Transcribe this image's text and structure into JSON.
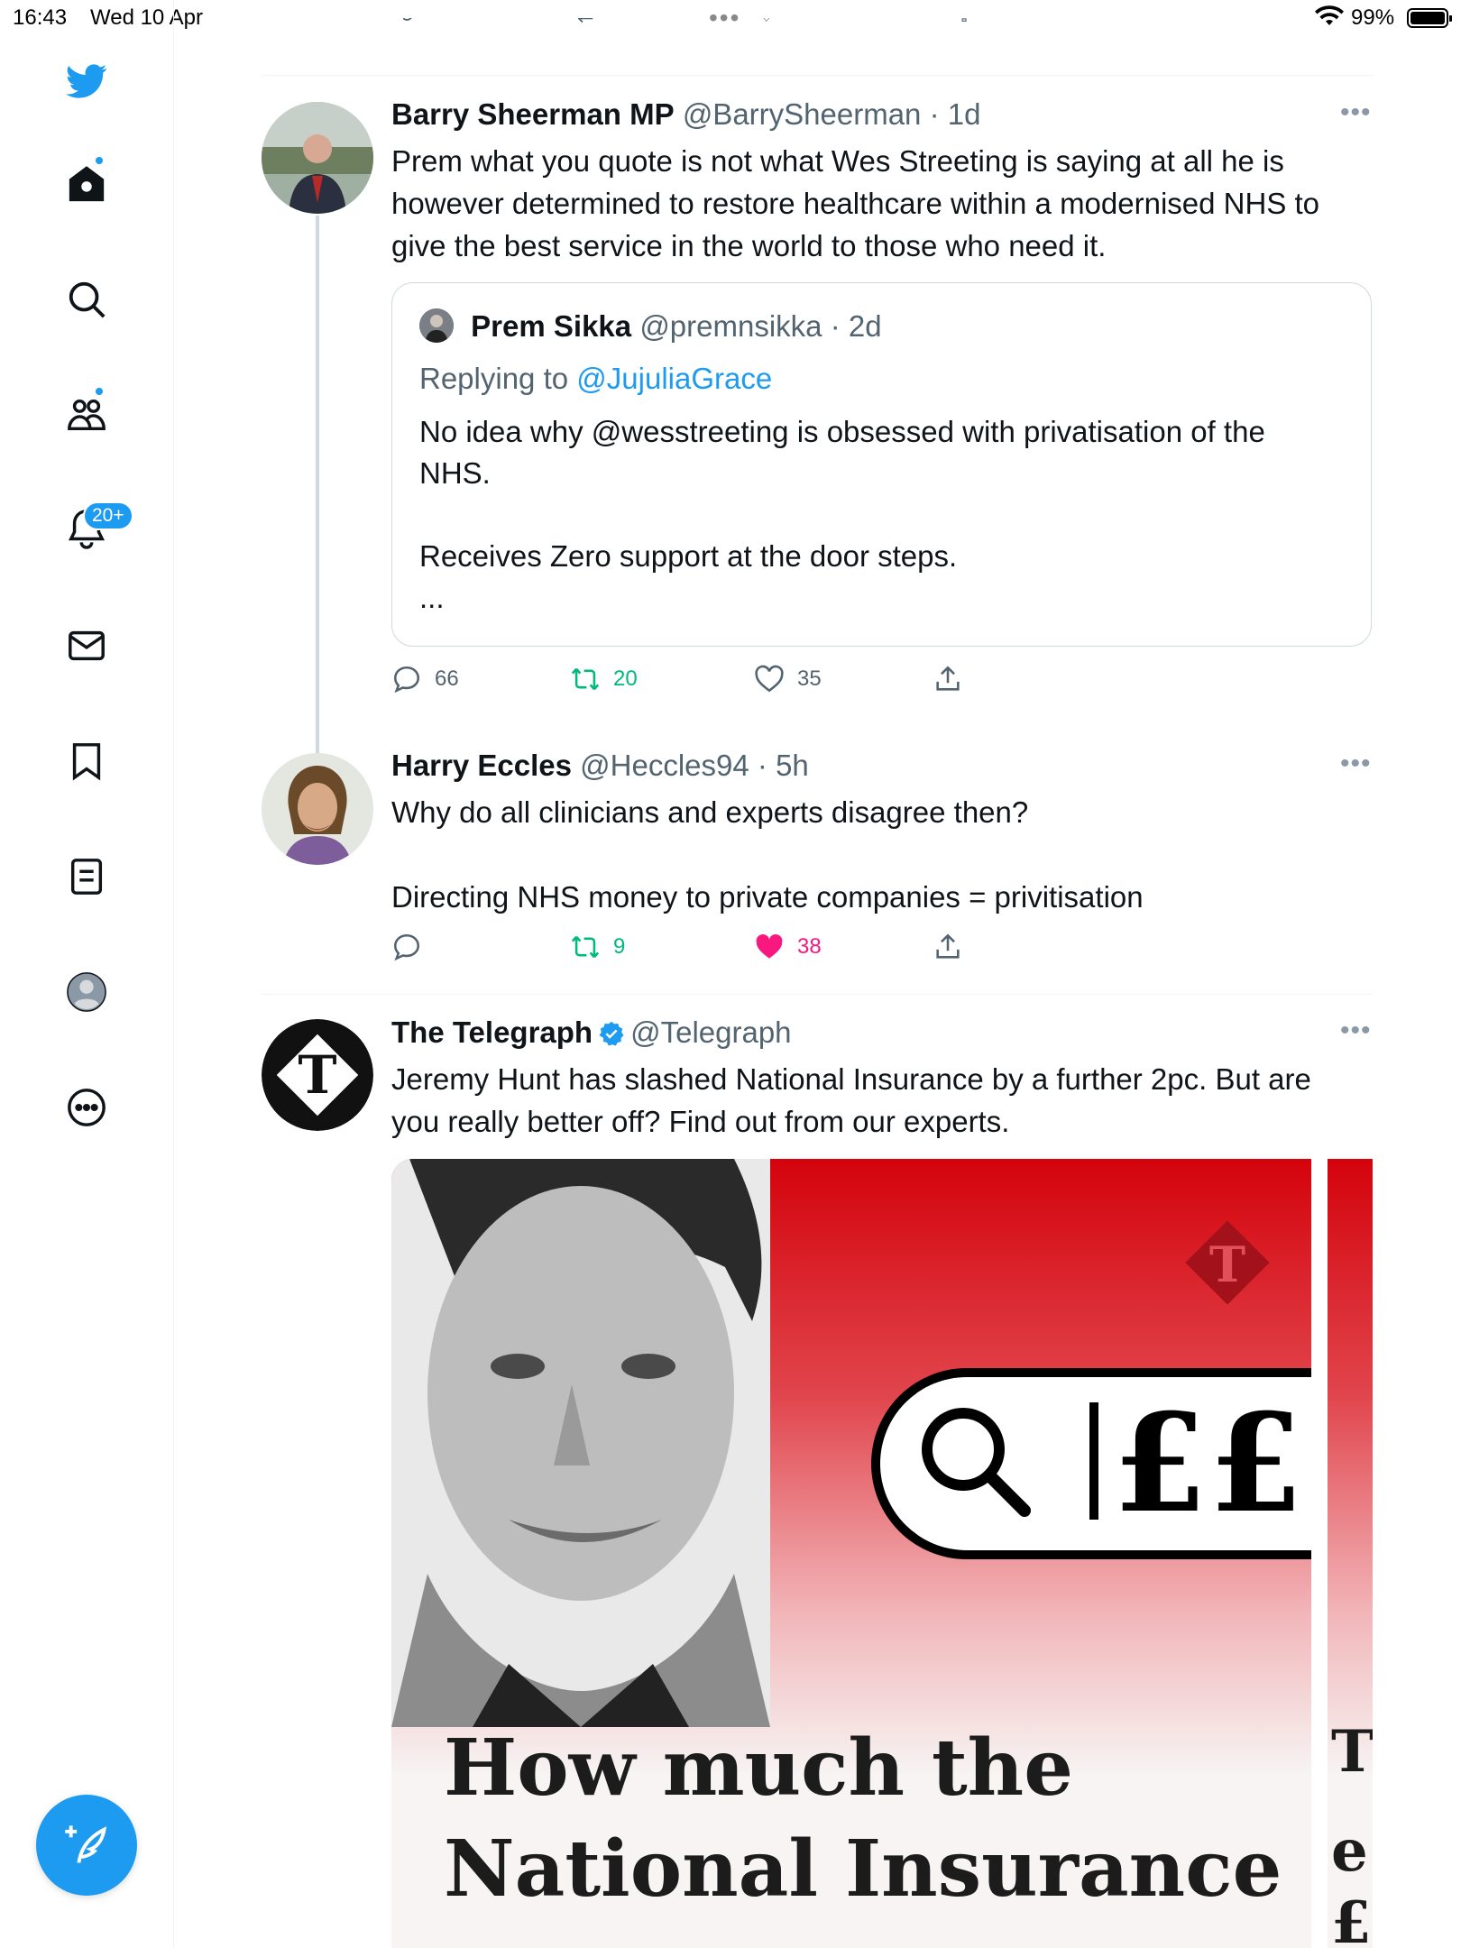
{
  "status_bar": {
    "time": "16:43",
    "date": "Wed 10 Apr",
    "battery": "99%",
    "battery_level": 0.99
  },
  "sidebar": {
    "notification_badge": "20+",
    "icons": [
      "twitter-bird-icon",
      "home-icon",
      "search-icon",
      "communities-icon",
      "notifications-icon",
      "messages-icon",
      "bookmarks-icon",
      "lists-icon",
      "profile-icon",
      "more-icon"
    ],
    "accent": "#1d9bf0"
  },
  "tweets": [
    {
      "name": "Barry Sheerman MP",
      "handle": "@BarrySheerman",
      "time": "· 1d",
      "text": "Prem what you quote is not what Wes Streeting is saying at all he is however determined to restore healthcare within a modernised NHS to give the best service in the world to those who need it.",
      "quote": {
        "name": "Prem Sikka",
        "handle": "@premnsikka",
        "time": "· 2d",
        "replying_prefix": "Replying to",
        "replying_to": "@JujuliaGrace",
        "text": "No idea why @wesstreeting is obsessed with privatisation of the NHS.\n\nReceives Zero support at the door steps.\n..."
      },
      "replies": "66",
      "retweets": "20",
      "likes": "35"
    },
    {
      "name": "Harry Eccles",
      "handle": "@Heccles94",
      "time": "· 5h",
      "text": "Why do all clinicians and experts disagree then?\n\nDirecting NHS money to private companies = privitisation",
      "replies": "",
      "retweets": "9",
      "likes": "38"
    },
    {
      "name": "The Telegraph",
      "handle": "@Telegraph",
      "text": "Jeremy Hunt has slashed National Insurance by a further 2pc. But are you really better off? Find out from our experts.",
      "media_headline": "How much the\nNational Insurance",
      "media_pounds": "££",
      "media_logo_letter": "T",
      "media2_fragments": [
        "T",
        "e",
        "£"
      ]
    }
  ]
}
